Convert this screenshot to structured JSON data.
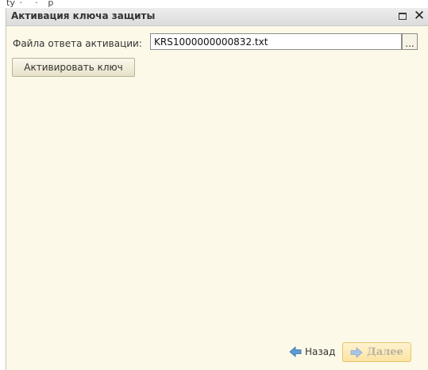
{
  "top_strip": {
    "text": "ty  ·     ·    р"
  },
  "window": {
    "title": "Активация ключа защиты",
    "maximize_icon": "maximize-icon",
    "close_icon": "close-icon"
  },
  "form": {
    "file_label": "Файла ответа активации:",
    "file_value": "KRS1000000000832.txt",
    "browse_label": "...",
    "activate_label": "Активировать ключ"
  },
  "footer": {
    "back_label": "Назад",
    "next_label": "Далее",
    "back_icon": "arrow-left-icon",
    "next_icon": "arrow-right-icon"
  },
  "colors": {
    "window_bg": "#fdf9e8",
    "titlebar_bg": "#e4e4e4",
    "back_arrow": "#5b9bd5",
    "next_arrow": "#a8c4e6"
  }
}
